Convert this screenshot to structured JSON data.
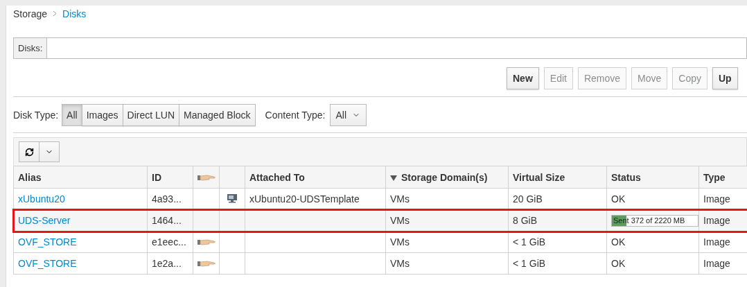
{
  "breadcrumb": [
    {
      "label": "Storage",
      "kind": "text"
    },
    {
      "label": "Disks",
      "kind": "link"
    }
  ],
  "search": {
    "label": "Disks:"
  },
  "actions": [
    {
      "label": "New",
      "disabled": false
    },
    {
      "label": "Edit",
      "disabled": true
    },
    {
      "label": "Remove",
      "disabled": true
    },
    {
      "label": "Move",
      "disabled": true
    },
    {
      "label": "Copy",
      "disabled": true
    },
    {
      "label": "Up",
      "disabled": false
    }
  ],
  "disk_type": {
    "label": "Disk Type:",
    "options": [
      {
        "label": "All",
        "selected": true
      },
      {
        "label": "Images",
        "selected": false
      },
      {
        "label": "Direct LUN",
        "selected": false
      },
      {
        "label": "Managed Block",
        "selected": false
      }
    ]
  },
  "content_type": {
    "label": "Content Type:",
    "value": "All"
  },
  "table": {
    "columns": [
      {
        "label": "Alias",
        "kind": "text"
      },
      {
        "label": "ID",
        "kind": "text"
      },
      {
        "kind": "hand-icon"
      },
      {
        "kind": "blank"
      },
      {
        "label": "Attached To",
        "kind": "text"
      },
      {
        "label": "Storage Domain(s)",
        "kind": "sorted"
      },
      {
        "label": "Virtual Size",
        "kind": "text"
      },
      {
        "label": "Status",
        "kind": "text"
      },
      {
        "label": "Type",
        "kind": "text"
      }
    ],
    "rows": [
      {
        "alias": "xUbuntu20",
        "id": "4a93...",
        "shareable": false,
        "attached_icon": true,
        "attached_to": "xUbuntu20-UDSTemplate",
        "storage_domain": "VMs",
        "virtual_size": "20 GiB",
        "status": {
          "kind": "text",
          "text": "OK"
        },
        "type": "Image",
        "highlighted": false
      },
      {
        "alias": "UDS-Server",
        "id": "1464...",
        "shareable": false,
        "attached_icon": false,
        "storage_domain": "VMs",
        "virtual_size": "8 GiB",
        "status": {
          "kind": "progress",
          "text": "Sent 372 of 2220 MB",
          "level": 0.17
        },
        "type": "Image",
        "highlighted": true
      },
      {
        "alias": "OVF_STORE",
        "id": "e1eec...",
        "shareable": true,
        "attached_icon": false,
        "storage_domain": "VMs",
        "virtual_size": "< 1 GiB",
        "status": {
          "kind": "text",
          "text": "OK"
        },
        "type": "Image",
        "highlighted": false
      },
      {
        "alias": "OVF_STORE",
        "id": "1e2a...",
        "shareable": true,
        "attached_icon": false,
        "storage_domain": "VMs",
        "virtual_size": "< 1 GiB",
        "status": {
          "kind": "text",
          "text": "OK"
        },
        "type": "Image",
        "highlighted": false
      }
    ]
  }
}
